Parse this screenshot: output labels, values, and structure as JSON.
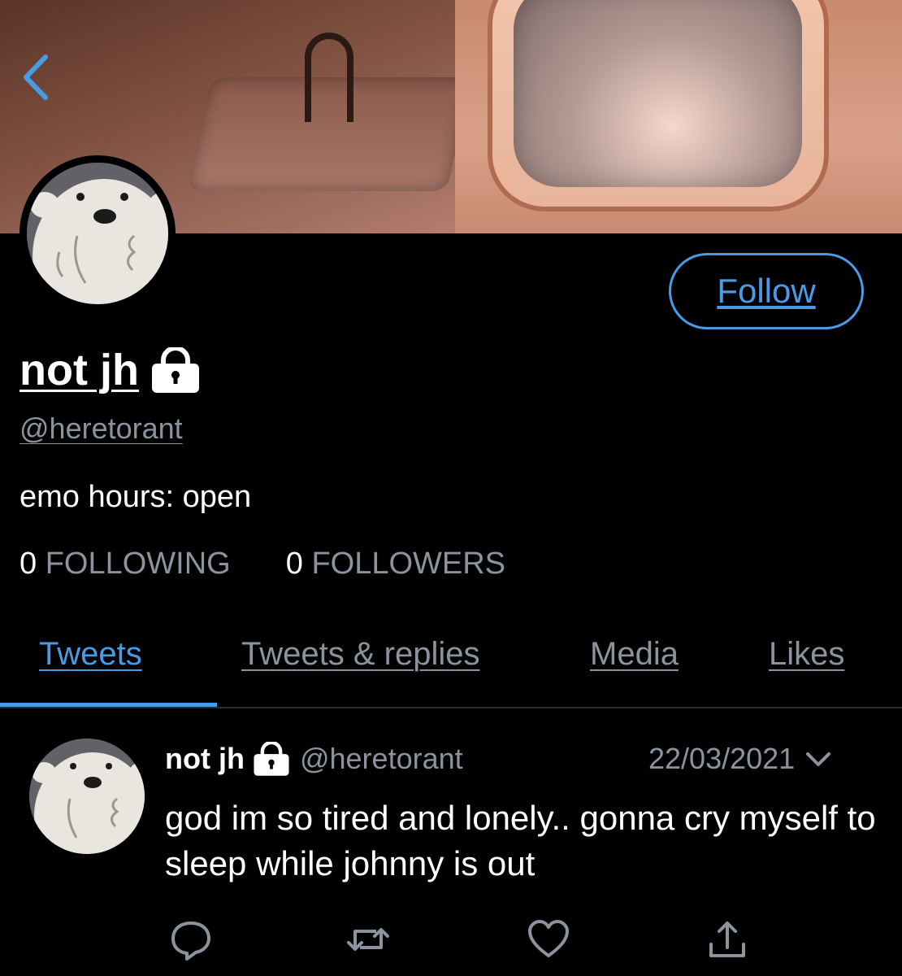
{
  "profile": {
    "display_name": "not jh",
    "handle": "@heretorant",
    "bio": "emo hours: open",
    "following_count": "0",
    "following_label": "FOLLOWING",
    "followers_count": "0",
    "followers_label": "FOLLOWERS",
    "protected_icon": "lock-icon"
  },
  "header": {
    "back_icon": "chevron-left-icon",
    "follow_label": "Follow"
  },
  "tabs": [
    {
      "label": "Tweets",
      "active": true
    },
    {
      "label": "Tweets & replies",
      "active": false
    },
    {
      "label": "Media",
      "active": false
    },
    {
      "label": "Likes",
      "active": false
    }
  ],
  "tweet": {
    "name": "not jh",
    "handle": "@heretorant",
    "date": "22/03/2021",
    "text": "god im so tired and lonely.. gonna cry myself to sleep while johnny is out",
    "actions": [
      "reply-icon",
      "retweet-icon",
      "like-icon",
      "share-icon"
    ]
  },
  "colors": {
    "accent": "#4a9be6",
    "muted": "#8b949e",
    "background": "#000000"
  }
}
